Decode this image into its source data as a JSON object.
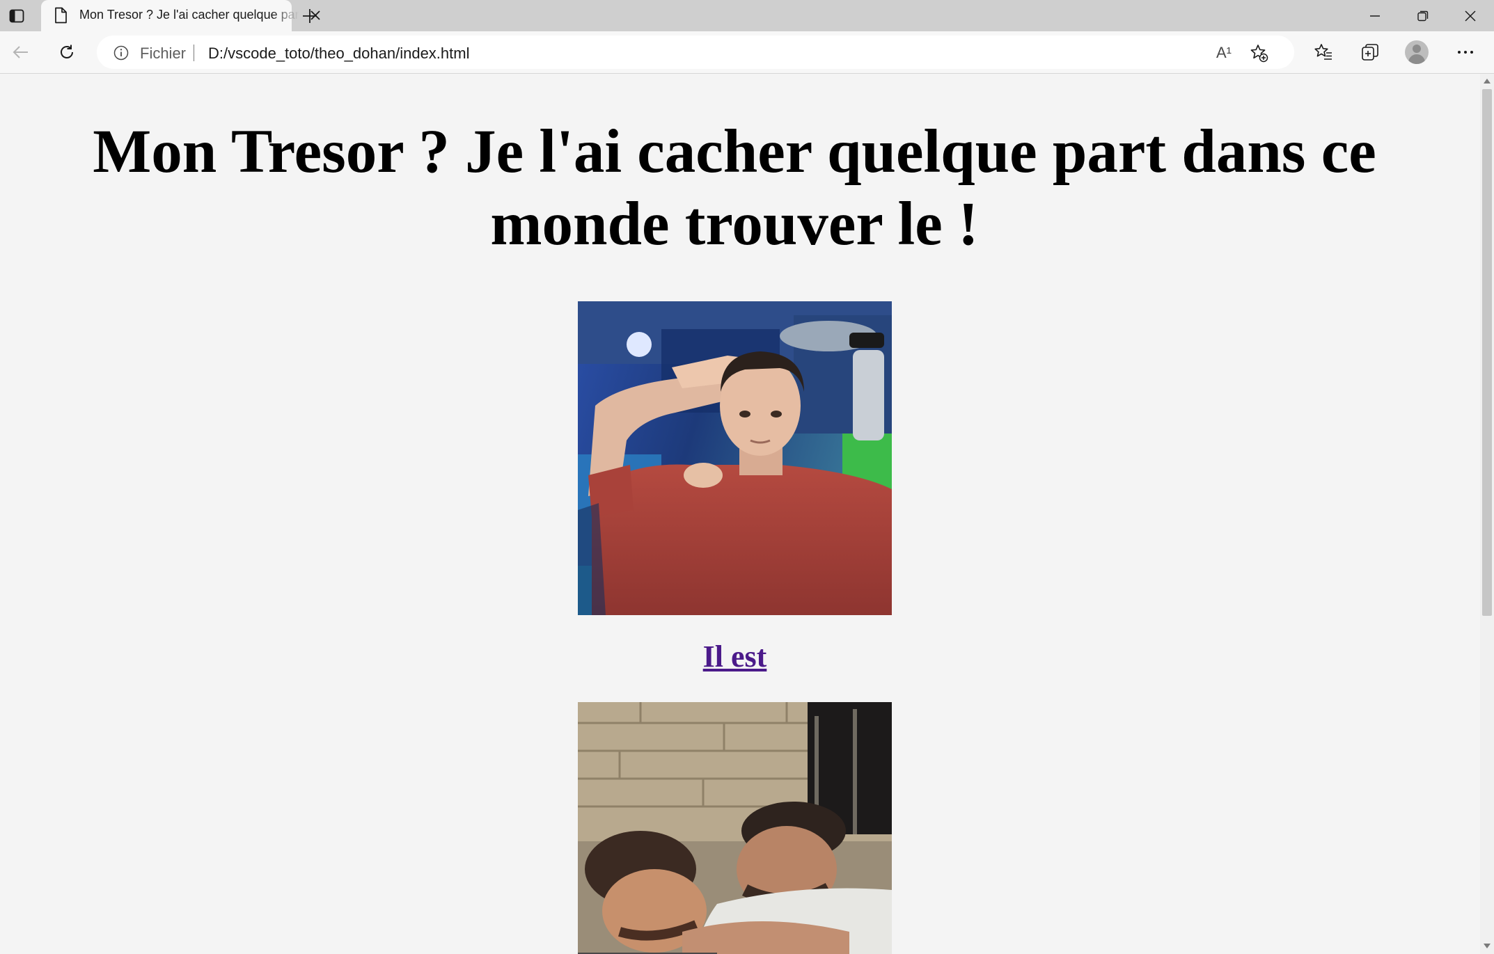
{
  "browser": {
    "tab_title": "Mon Tresor ? Je l'ai cacher quelque part dans ce monde trouver le !",
    "address": {
      "site_label": "Fichier",
      "url": "D:/vscode_toto/theo_dohan/index.html"
    },
    "icons": {
      "read_aloud": "A¹"
    }
  },
  "page": {
    "heading": "Mon Tresor ? Je l'ai cacher quelque part dans ce monde trouver le !",
    "link_text": "Il est"
  },
  "colors": {
    "tab_strip": "#cfcfcf",
    "toolbar": "#f7f7f7",
    "page_background": "#f4f4f4",
    "visited_link": "#4b1a8a"
  }
}
